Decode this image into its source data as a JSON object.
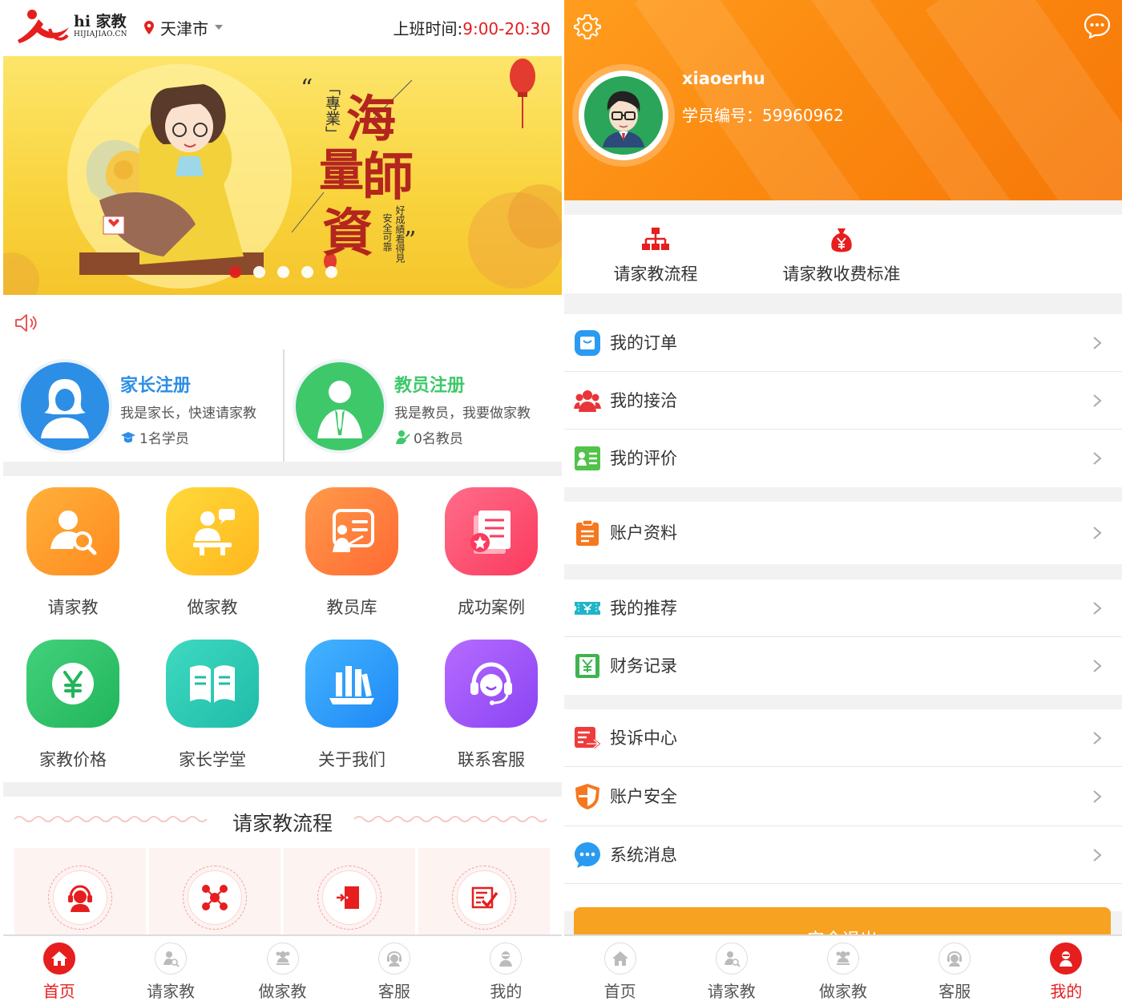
{
  "home": {
    "logo": {
      "text": "hi 家教",
      "sub": "HIJIAJIAO.CN"
    },
    "city": "天津市",
    "hours_label": "上班时间:",
    "hours_value": "9:00-20:30",
    "banner": {
      "text_vertical_1": "「專業」",
      "big_chars": [
        "海",
        "量",
        "師",
        "資"
      ],
      "small_text": [
        "好成績看得見",
        "安全可靠"
      ],
      "carousel_count": 5,
      "carousel_active": 1
    },
    "parent_reg": {
      "title": "家长注册",
      "desc": "我是家长，快速请家教",
      "count": "1名学员"
    },
    "teacher_reg": {
      "title": "教员注册",
      "desc": "我是教员，我要做家教",
      "count": "0名教员"
    },
    "grid": [
      {
        "label": "请家教",
        "icon": "search-user-icon",
        "color1": "#ffb13b",
        "color2": "#ff8a1f"
      },
      {
        "label": "做家教",
        "icon": "tutor-chat-icon",
        "color1": "#ffd93b",
        "color2": "#ffb71d"
      },
      {
        "label": "教员库",
        "icon": "teacher-board-icon",
        "color1": "#ff9a4a",
        "color2": "#ff6a33"
      },
      {
        "label": "成功案例",
        "icon": "case-book-icon",
        "color1": "#ff6d8a",
        "color2": "#fb3a5e"
      },
      {
        "label": "家教价格",
        "icon": "yen-icon",
        "color1": "#43d17c",
        "color2": "#21b55a"
      },
      {
        "label": "家长学堂",
        "icon": "open-book-icon",
        "color1": "#3fd9c1",
        "color2": "#1fbca8"
      },
      {
        "label": "关于我们",
        "icon": "library-icon",
        "color1": "#44b4ff",
        "color2": "#1e88f5"
      },
      {
        "label": "联系客服",
        "icon": "headset-icon",
        "color1": "#b66bff",
        "color2": "#8a44f3"
      }
    ],
    "process_title": "请家教流程",
    "process_steps": [
      "headset-agent-icon",
      "network-icon",
      "door-icon",
      "checklist-icon"
    ],
    "tabbar": [
      {
        "label": "首页",
        "icon": "home-icon",
        "active": true
      },
      {
        "label": "请家教",
        "icon": "search-user-icon",
        "active": false
      },
      {
        "label": "做家教",
        "icon": "tutor-icon",
        "active": false
      },
      {
        "label": "客服",
        "icon": "headset-icon",
        "active": false
      },
      {
        "label": "我的",
        "icon": "profile-icon",
        "active": false
      }
    ]
  },
  "mine": {
    "username": "xiaoerhu",
    "student_no": "学员编号：59960962",
    "quick": [
      {
        "label": "请家教流程",
        "icon": "flowchart-icon"
      },
      {
        "label": "请家教收费标准",
        "icon": "money-bag-icon"
      }
    ],
    "menu_groups": [
      [
        {
          "label": "我的订单",
          "icon": "order-bag-icon",
          "color": "#2a9bf0"
        },
        {
          "label": "我的接洽",
          "icon": "contacts-icon",
          "color": "#e8353a"
        },
        {
          "label": "我的评价",
          "icon": "review-card-icon",
          "color": "#52c24a"
        }
      ],
      [
        {
          "label": "账户资料",
          "icon": "clipboard-icon",
          "color": "#f5781e"
        }
      ],
      [
        {
          "label": "我的推荐",
          "icon": "ticket-icon",
          "color": "#1fb5c8"
        },
        {
          "label": "财务记录",
          "icon": "yen-ledger-icon",
          "color": "#3fb34f"
        }
      ],
      [
        {
          "label": "投诉中心",
          "icon": "complaint-icon",
          "color": "#ef3b3b"
        },
        {
          "label": "账户安全",
          "icon": "shield-icon",
          "color": "#f5781e"
        },
        {
          "label": "系统消息",
          "icon": "message-bubble-icon",
          "color": "#2a9bf0"
        }
      ]
    ],
    "logout": "安全退出",
    "tabbar": [
      {
        "label": "首页",
        "icon": "home-icon",
        "active": false
      },
      {
        "label": "请家教",
        "icon": "search-user-icon",
        "active": false
      },
      {
        "label": "做家教",
        "icon": "tutor-icon",
        "active": false
      },
      {
        "label": "客服",
        "icon": "headset-icon",
        "active": false
      },
      {
        "label": "我的",
        "icon": "profile-icon",
        "active": true
      }
    ]
  }
}
